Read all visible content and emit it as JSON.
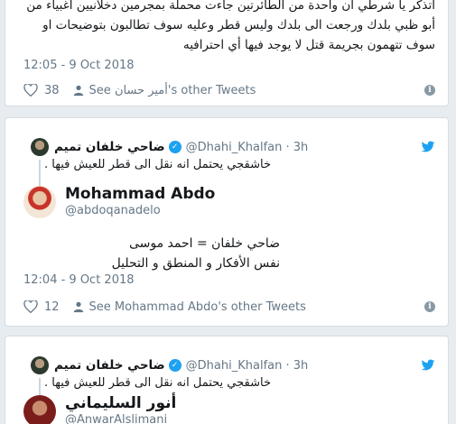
{
  "tweet1": {
    "text": "اتذكر يا شرطي أن واحدة من الطائرتين جاءت محملة بمجرمين دخلانيين أغبياء من أبو ظبي بلدك ورجعت الى بلدك وليس قطر وعليه سوف تطالبون بتوضيحات او سوف تتهمون بجريمة قتل لا يوجد فيها أي احترافيه",
    "timestamp": "12:05 - 9 Oct 2018",
    "likes": "38",
    "see_other": "See أمير حسان's other Tweets"
  },
  "tweet2": {
    "quoted_name": "ضاحي خلفان تميم",
    "quoted_handle": "@Dhahi_Khalfan · 3h",
    "quoted_text": "خاشقجي يحتمل انه نقل الى قطر للعيش فيها .",
    "reply_name": "Mohammad Abdo",
    "reply_handle": "@abdoqanadelo",
    "reply_line1": "ضاحي خلفان = احمد موسى",
    "reply_line2": "نفس الأفكار و المنطق و التحليل",
    "timestamp": "12:04 - 9 Oct 2018",
    "likes": "12",
    "see_other": "See Mohammad Abdo's other Tweets"
  },
  "tweet3": {
    "quoted_name": "ضاحي خلفان تميم",
    "quoted_handle": "@Dhahi_Khalfan · 3h",
    "quoted_text": "خاشقجي يحتمل انه نقل الى قطر للعيش فيها .",
    "reply_name": "أنور السليماني",
    "reply_handle": "@AnwarAlslimani"
  },
  "icons": {
    "verified": "verified-badge-icon",
    "bird": "twitter-bird-icon",
    "heart": "heart-icon",
    "person": "person-icon",
    "info": "info-icon"
  },
  "colors": {
    "accent": "#1da1f2",
    "muted": "#657786",
    "background": "#e6ecf0"
  }
}
